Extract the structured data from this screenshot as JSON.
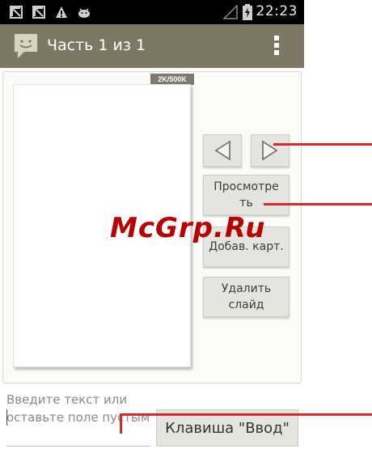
{
  "status_bar": {
    "time": "22:23",
    "icons": [
      "notification-icon",
      "notification-icon",
      "warning-icon",
      "android-icon",
      "signal-icon",
      "battery-icon"
    ]
  },
  "action_bar": {
    "title": "Часть 1 из 1",
    "logo_icon": "message-icon",
    "menu_icon": "overflow-menu-icon"
  },
  "slide": {
    "size_badge": "2K/500K"
  },
  "buttons": {
    "prev_icon": "triangle-left-icon",
    "next_icon": "triangle-right-icon",
    "preview": "Просмотре ть",
    "add_picture": "Добав. карт.",
    "delete_slide": "Удалить слайд"
  },
  "compose": {
    "placeholder": "Введите текст или оставьте поле пустым",
    "enter_button": "Клавиша \"Ввод\""
  },
  "watermark": "McGrp.Ru",
  "colors": {
    "action_bar": "#7e7764",
    "status_bar": "#000000",
    "callout": "#d72b2b",
    "watermark": "#b80000"
  }
}
